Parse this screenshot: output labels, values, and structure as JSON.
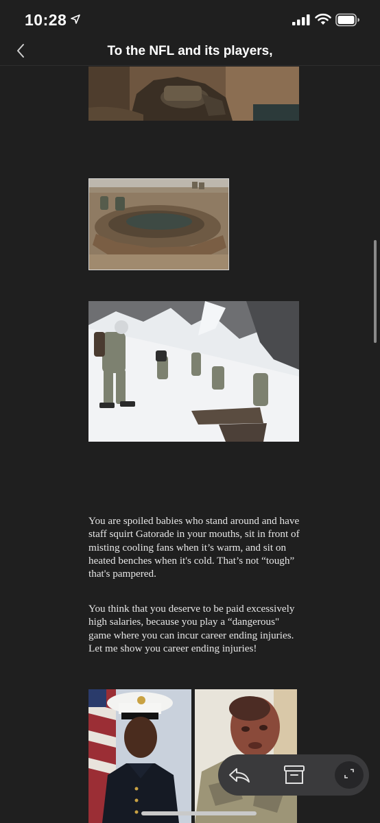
{
  "status_bar": {
    "time": "10:28",
    "icons": [
      "location-arrow-icon",
      "cellular-signal-icon",
      "wifi-icon",
      "battery-icon"
    ]
  },
  "nav": {
    "back_icon": "chevron-left-icon",
    "title": "To the NFL and its players,"
  },
  "content": {
    "photos": [
      {
        "name": "photo-soldiers-resting-wall"
      },
      {
        "name": "photo-soldiers-muddy-bunker"
      },
      {
        "name": "photo-soldiers-snow-mountain"
      },
      {
        "name": "photo-marine-portrait"
      },
      {
        "name": "photo-burned-veteran"
      }
    ],
    "paragraphs": [
      "You are spoiled babies who stand around and have staff squirt Gatorade in your mouths, sit in front of misting cooling fans when it’s warm, and sit on heated benches when it's cold. That’s not “tough” that's pampered.",
      "You think that you deserve to be paid excessively high salaries, because you play a “dangerous\" game where you can incur career ending injuries. Let me show you career ending injuries!"
    ]
  },
  "toolbar": {
    "icons": [
      "reply-icon",
      "archive-icon",
      "expand-icon"
    ]
  },
  "colors": {
    "background": "#1f1f1f",
    "toolbar": "#3a3a3c",
    "text": "#e6e6e6"
  }
}
